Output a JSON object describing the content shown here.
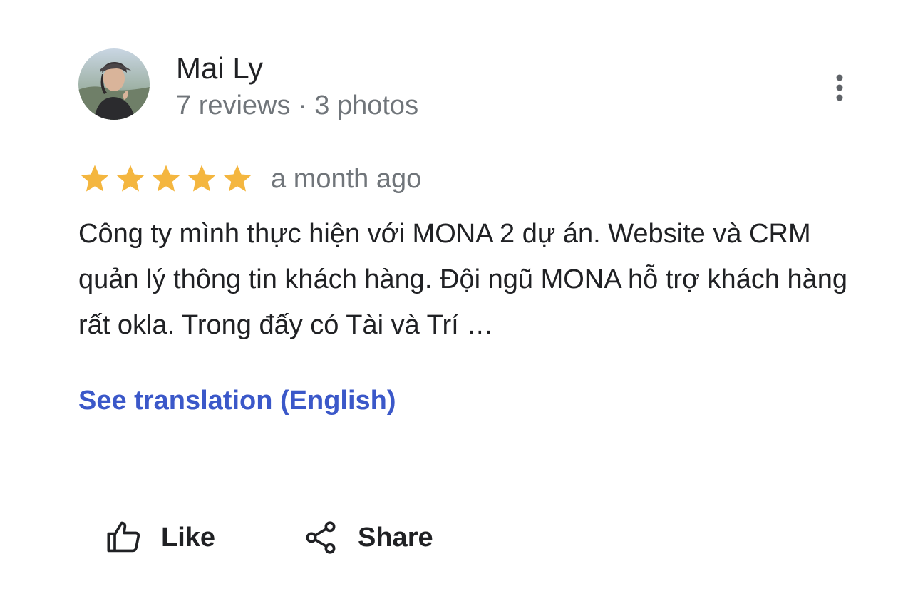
{
  "author": {
    "name": "Mai Ly",
    "reviews_count": "7 reviews",
    "separator": " · ",
    "photos_count": "3 photos",
    "avatar_icon": "user-photo-avatar"
  },
  "menu": {
    "icon": "more-vert-icon"
  },
  "rating": {
    "stars": 5,
    "max_stars": 5,
    "star_color": "#f4b63f",
    "date": "a month ago"
  },
  "review": {
    "text": "Công ty mình thực hiện với MONA 2 dự án. Website và CRM quản lý thông tin khách hàng. Đội ngũ MONA hỗ trợ khách hàng rất okla. Trong đấy có Tài và Trí …"
  },
  "translation": {
    "link": "See translation (English)",
    "color": "#3b58c9"
  },
  "actions": {
    "like_label": "Like",
    "like_icon": "thumb-up-icon",
    "share_label": "Share",
    "share_icon": "share-icon"
  }
}
